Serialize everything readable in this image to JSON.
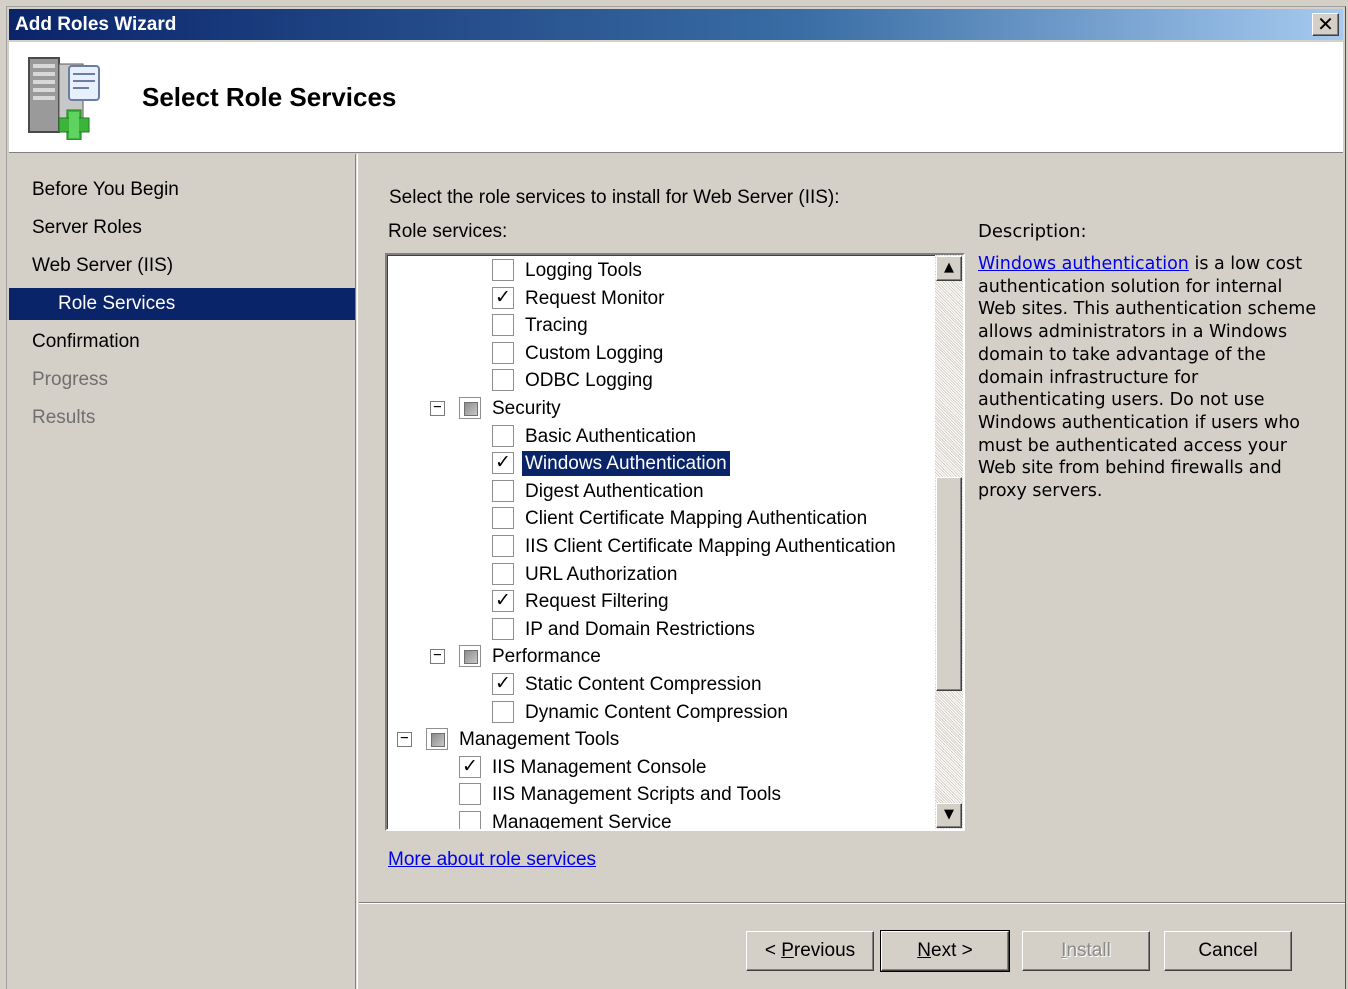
{
  "window": {
    "title": "Add Roles Wizard",
    "close_glyph": "✕",
    "colors": {
      "titlebar": "#0a246a",
      "selection": "#0a246a",
      "face": "#d4d0c8",
      "link": "#0000ee"
    }
  },
  "header": {
    "title": "Select Role Services",
    "icon": "server-add-icon"
  },
  "nav": {
    "items": [
      {
        "label": "Before You Begin",
        "state": "normal"
      },
      {
        "label": "Server Roles",
        "state": "normal"
      },
      {
        "label": "Web Server (IIS)",
        "state": "normal"
      },
      {
        "label": "Role Services",
        "state": "selected"
      },
      {
        "label": "Confirmation",
        "state": "normal"
      },
      {
        "label": "Progress",
        "state": "disabled"
      },
      {
        "label": "Results",
        "state": "disabled"
      }
    ]
  },
  "content": {
    "intro": "Select the role services to install for Web Server (IIS):",
    "role_services_label": "Role services:",
    "description_label": "Description:"
  },
  "tree": {
    "items": [
      {
        "label": "Logging Tools",
        "checked": false
      },
      {
        "label": "Request Monitor",
        "checked": true
      },
      {
        "label": "Tracing",
        "checked": false
      },
      {
        "label": "Custom Logging",
        "checked": false
      },
      {
        "label": "ODBC Logging",
        "checked": false
      },
      {
        "label": "Security",
        "checked": "partial",
        "expander": "−"
      },
      {
        "label": "Basic Authentication",
        "checked": false
      },
      {
        "label": "Windows Authentication",
        "checked": true,
        "selected": true
      },
      {
        "label": "Digest Authentication",
        "checked": false
      },
      {
        "label": "Client Certificate Mapping Authentication",
        "checked": false
      },
      {
        "label": "IIS Client Certificate Mapping Authentication",
        "checked": false
      },
      {
        "label": "URL Authorization",
        "checked": false
      },
      {
        "label": "Request Filtering",
        "checked": true
      },
      {
        "label": "IP and Domain Restrictions",
        "checked": false
      },
      {
        "label": "Performance",
        "checked": "partial",
        "expander": "−"
      },
      {
        "label": "Static Content Compression",
        "checked": true
      },
      {
        "label": "Dynamic Content Compression",
        "checked": false
      },
      {
        "label": "Management Tools",
        "checked": "partial",
        "expander": "−"
      },
      {
        "label": "IIS Management Console",
        "checked": true
      },
      {
        "label": "IIS Management Scripts and Tools",
        "checked": false
      },
      {
        "label": "Management Service",
        "checked": false
      }
    ],
    "check_glyph": "✓",
    "scroll_up_glyph": "▲",
    "scroll_down_glyph": "▼"
  },
  "description": {
    "link": "Windows authentication",
    "text": " is a low cost authentication solution for internal Web sites. This authentication scheme allows administrators in a Windows domain to take advantage of the domain infrastructure for authenticating users. Do not use Windows authentication if users who must be authenticated access your Web site from behind firewalls and proxy servers."
  },
  "more_link": "More about role services",
  "buttons": {
    "previous": {
      "before": "< ",
      "mnemonic": "P",
      "after": "revious"
    },
    "next": {
      "mnemonic": "N",
      "after": "ext >"
    },
    "install": {
      "mnemonic": "I",
      "after": "nstall"
    },
    "cancel": "Cancel"
  }
}
